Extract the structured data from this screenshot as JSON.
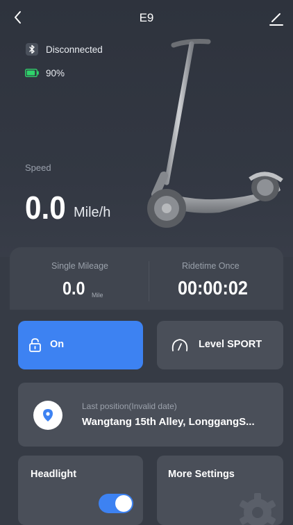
{
  "header": {
    "title": "E9",
    "back_icon": "chevron-left-icon",
    "edit_icon": "pencil-icon"
  },
  "status": {
    "bluetooth_icon": "bluetooth-icon",
    "bluetooth_label": "Disconnected",
    "battery_icon": "battery-icon",
    "battery_label": "90%",
    "battery_level": 0.9
  },
  "speed": {
    "label": "Speed",
    "value": "0.0",
    "unit": "Mile/h"
  },
  "stats": {
    "single_mileage_label": "Single Mileage",
    "single_mileage_value": "0.0",
    "single_mileage_unit": "Mile",
    "ridetime_label": "Ridetime Once",
    "ridetime_value": "00:00:02"
  },
  "lock": {
    "label": "On",
    "icon": "unlock-icon",
    "color": "#3d82f2"
  },
  "level": {
    "label": "Level SPORT",
    "icon": "speedometer-icon"
  },
  "position": {
    "label": "Last position(Invalid date)",
    "address": "Wangtang 15th Alley, LonggangS...",
    "icon": "location-pin-icon"
  },
  "headlight": {
    "label": "Headlight",
    "enabled": true
  },
  "more_settings": {
    "label": "More Settings",
    "icon": "gear-icon"
  }
}
